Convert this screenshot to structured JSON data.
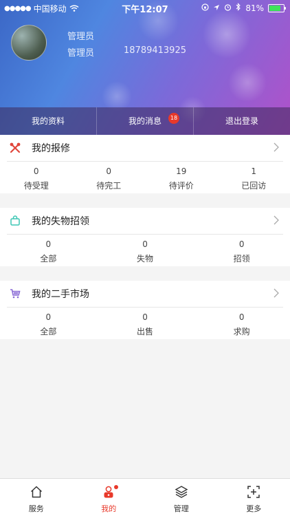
{
  "status_bar": {
    "carrier": "中国移动",
    "time": "下午12:07",
    "battery": "81%",
    "battery_level": 0.81
  },
  "profile": {
    "role": "管理员",
    "name": "管理员",
    "phone": "18789413925"
  },
  "header_tabs": {
    "profile_label": "我的资料",
    "messages_label": "我的消息",
    "messages_badge": "18",
    "logout_label": "退出登录"
  },
  "sections": {
    "repair": {
      "title": "我的报修",
      "stats": [
        {
          "value": "0",
          "label": "待受理"
        },
        {
          "value": "0",
          "label": "待完工"
        },
        {
          "value": "19",
          "label": "待评价"
        },
        {
          "value": "1",
          "label": "已回访"
        }
      ]
    },
    "lost_found": {
      "title": "我的失物招领",
      "stats": [
        {
          "value": "0",
          "label": "全部"
        },
        {
          "value": "0",
          "label": "失物"
        },
        {
          "value": "0",
          "label": "招领"
        }
      ]
    },
    "market": {
      "title": "我的二手市场",
      "stats": [
        {
          "value": "0",
          "label": "全部"
        },
        {
          "value": "0",
          "label": "出售"
        },
        {
          "value": "0",
          "label": "求购"
        }
      ]
    }
  },
  "tabbar": {
    "items": [
      {
        "label": "服务",
        "icon": "home-icon"
      },
      {
        "label": "我的",
        "icon": "user-icon"
      },
      {
        "label": "管理",
        "icon": "layers-icon"
      },
      {
        "label": "更多",
        "icon": "scan-plus-icon"
      }
    ]
  },
  "colors": {
    "accent": "#e8392a",
    "repair_icon": "#e0463b",
    "lost_icon": "#3cc6b4",
    "market_icon": "#8a6bd6"
  }
}
